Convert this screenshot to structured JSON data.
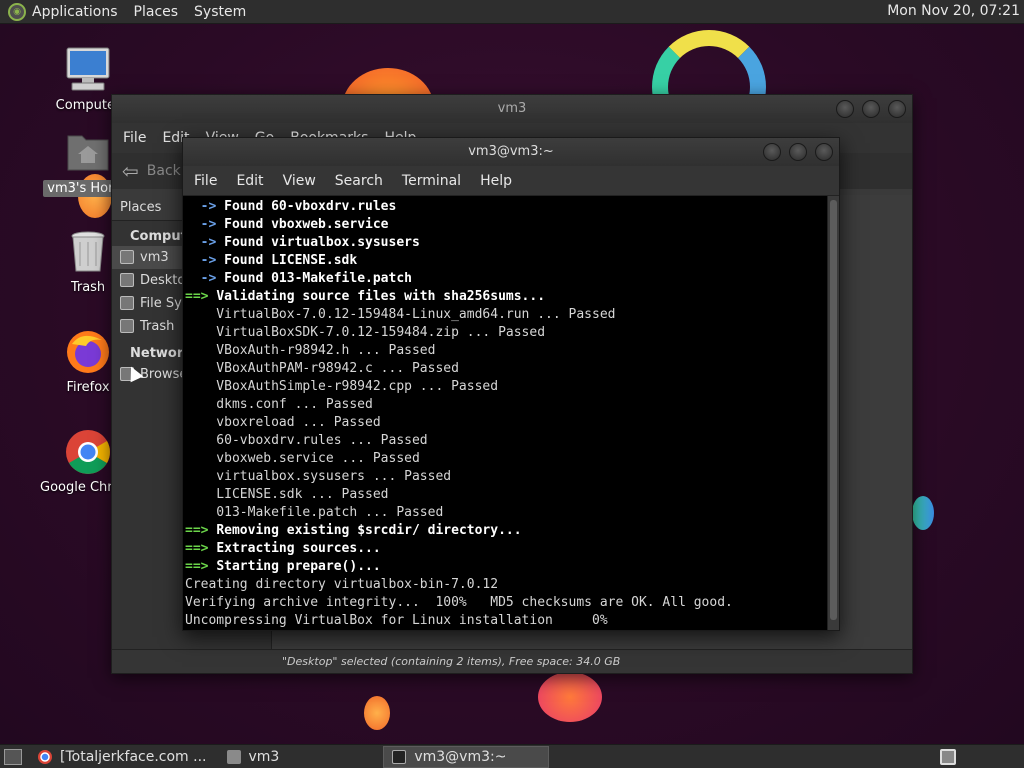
{
  "top_panel": {
    "menus": [
      "Applications",
      "Places",
      "System"
    ],
    "clock": "Mon Nov 20, 07:21"
  },
  "desktop_icons": [
    {
      "label": "Computer",
      "icon": "computer-icon"
    },
    {
      "label": "vm3's Home",
      "icon": "home-folder-icon"
    },
    {
      "label": "Trash",
      "icon": "trash-icon"
    },
    {
      "label": "Firefox",
      "icon": "firefox-icon"
    },
    {
      "label": "Google Chrome",
      "icon": "chrome-icon"
    }
  ],
  "file_manager": {
    "title": "vm3",
    "menu": [
      "File",
      "Edit",
      "View",
      "Go",
      "Bookmarks",
      "Help"
    ],
    "back_label": "Back",
    "places_header": "Places",
    "sections": {
      "computer": "Computer",
      "network": "Network"
    },
    "computer_items": [
      "vm3",
      "Desktop",
      "File System",
      "Trash"
    ],
    "network_items": [
      "Browse Network"
    ],
    "status": "\"Desktop\" selected (containing 2 items), Free space: 34.0 GB"
  },
  "terminal": {
    "title": "vm3@vm3:~",
    "menu": [
      "File",
      "Edit",
      "View",
      "Search",
      "Terminal",
      "Help"
    ],
    "lines": [
      {
        "kind": "found",
        "text": "Found 60-vboxdrv.rules"
      },
      {
        "kind": "found",
        "text": "Found vboxweb.service"
      },
      {
        "kind": "found",
        "text": "Found virtualbox.sysusers"
      },
      {
        "kind": "found",
        "text": "Found LICENSE.sdk"
      },
      {
        "kind": "found",
        "text": "Found 013-Makefile.patch"
      },
      {
        "kind": "step",
        "text": "Validating source files with sha256sums..."
      },
      {
        "kind": "plain",
        "text": "    VirtualBox-7.0.12-159484-Linux_amd64.run ... Passed"
      },
      {
        "kind": "plain",
        "text": "    VirtualBoxSDK-7.0.12-159484.zip ... Passed"
      },
      {
        "kind": "plain",
        "text": "    VBoxAuth-r98942.h ... Passed"
      },
      {
        "kind": "plain",
        "text": "    VBoxAuthPAM-r98942.c ... Passed"
      },
      {
        "kind": "plain",
        "text": "    VBoxAuthSimple-r98942.cpp ... Passed"
      },
      {
        "kind": "plain",
        "text": "    dkms.conf ... Passed"
      },
      {
        "kind": "plain",
        "text": "    vboxreload ... Passed"
      },
      {
        "kind": "plain",
        "text": "    60-vboxdrv.rules ... Passed"
      },
      {
        "kind": "plain",
        "text": "    vboxweb.service ... Passed"
      },
      {
        "kind": "plain",
        "text": "    virtualbox.sysusers ... Passed"
      },
      {
        "kind": "plain",
        "text": "    LICENSE.sdk ... Passed"
      },
      {
        "kind": "plain",
        "text": "    013-Makefile.patch ... Passed"
      },
      {
        "kind": "step",
        "text": "Removing existing $srcdir/ directory..."
      },
      {
        "kind": "step",
        "text": "Extracting sources..."
      },
      {
        "kind": "step",
        "text": "Starting prepare()..."
      },
      {
        "kind": "plain",
        "text": "Creating directory virtualbox-bin-7.0.12"
      },
      {
        "kind": "plain",
        "text": "Verifying archive integrity...  100%   MD5 checksums are OK. All good."
      },
      {
        "kind": "plain",
        "text": "Uncompressing VirtualBox for Linux installation     0%"
      }
    ],
    "arrow_found": "  ->",
    "arrow_step": "==>"
  },
  "taskbar": {
    "items": [
      {
        "label": "[Totaljerkface.com ...",
        "icon": "chrome-icon",
        "active": false
      },
      {
        "label": "vm3",
        "icon": "home-folder-icon",
        "active": false
      },
      {
        "label": "vm3@vm3:~",
        "icon": "terminal-icon",
        "active": true
      }
    ]
  },
  "colors": {
    "wallpaper": "#2c0b24",
    "prompt_green": "#6cd64a",
    "prompt_blue": "#6aa0e8"
  }
}
